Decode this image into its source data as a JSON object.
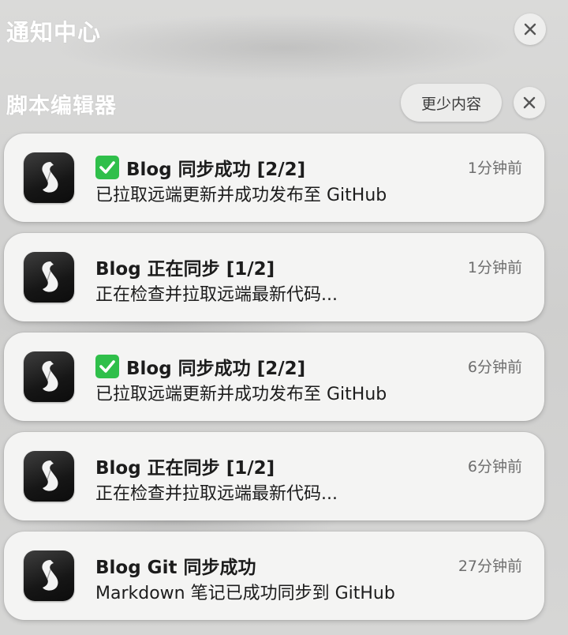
{
  "header": {
    "title": "通知中心",
    "close_icon": "close-icon"
  },
  "group": {
    "name": "脚本编辑器",
    "less_label": "更少内容",
    "close_icon": "close-icon"
  },
  "notifications": [
    {
      "has_check": true,
      "title": "Blog 同步成功 [2/2]",
      "body": "已拉取远端更新并成功发布至 GitHub",
      "time": "1分钟前"
    },
    {
      "has_check": false,
      "title": "Blog 正在同步 [1/2]",
      "body": "正在检查并拉取远端最新代码...",
      "time": "1分钟前"
    },
    {
      "has_check": true,
      "title": "Blog 同步成功 [2/2]",
      "body": "已拉取远端更新并成功发布至 GitHub",
      "time": "6分钟前"
    },
    {
      "has_check": false,
      "title": "Blog 正在同步 [1/2]",
      "body": "正在检查并拉取远端最新代码...",
      "time": "6分钟前"
    },
    {
      "has_check": false,
      "title": "Blog Git 同步成功",
      "body": "Markdown 笔记已成功同步到 GitHub",
      "time": "27分钟前"
    }
  ],
  "icons": {
    "app": "script-editor-icon",
    "check": "check-mark-icon"
  },
  "colors": {
    "check_green": "#2fbf4a",
    "card_bg": "#f4f4f3",
    "header_text": "#ffffff"
  }
}
